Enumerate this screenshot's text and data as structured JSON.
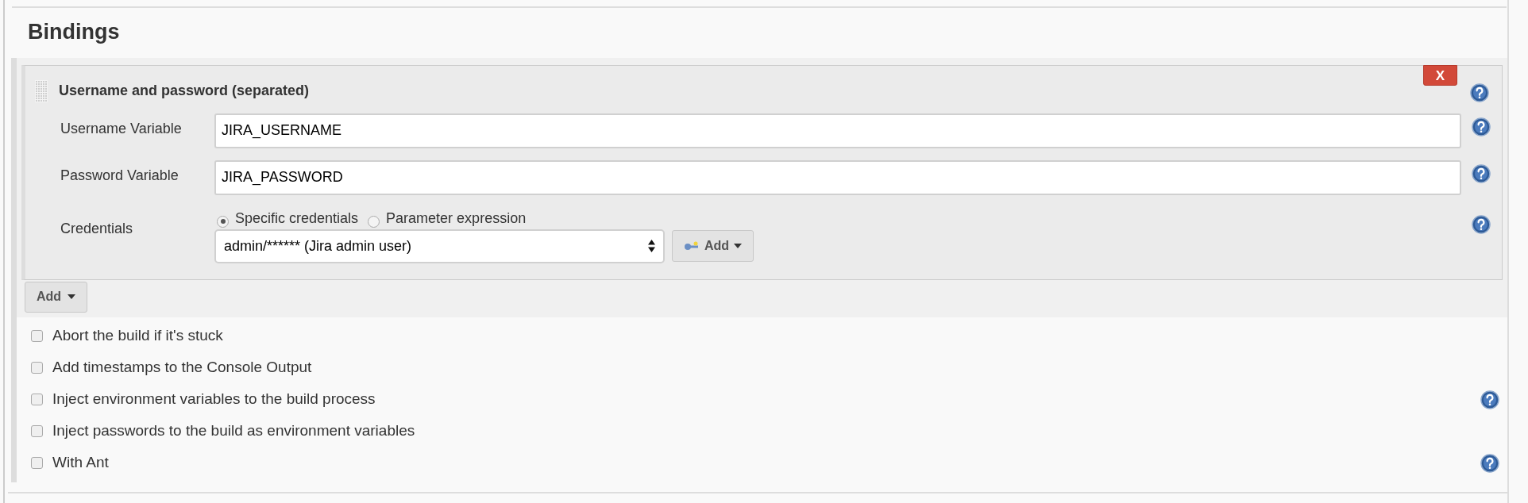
{
  "section_title": "Bindings",
  "binding": {
    "title": "Username and password (separated)",
    "delete_label": "X",
    "fields": [
      {
        "kind": "text",
        "label": "Username Variable",
        "value": "JIRA_USERNAME"
      },
      {
        "kind": "text",
        "label": "Password Variable",
        "value": "JIRA_PASSWORD"
      },
      {
        "kind": "credentials",
        "label": "Credentials",
        "options": [
          {
            "label": "Specific credentials",
            "selected": true
          },
          {
            "label": "Parameter expression",
            "selected": false
          }
        ],
        "value": "admin/****** (Jira admin user)",
        "add_label": "Add"
      }
    ]
  },
  "add_label": "Add",
  "options": [
    {
      "label": "Abort the build if it's stuck",
      "checked": false,
      "help": false
    },
    {
      "label": "Add timestamps to the Console Output",
      "checked": false,
      "help": false
    },
    {
      "label": "Inject environment variables to the build process",
      "checked": false,
      "help": true
    },
    {
      "label": "Inject passwords to the build as environment variables",
      "checked": false,
      "help": false
    },
    {
      "label": "With Ant",
      "checked": false,
      "help": true
    }
  ]
}
